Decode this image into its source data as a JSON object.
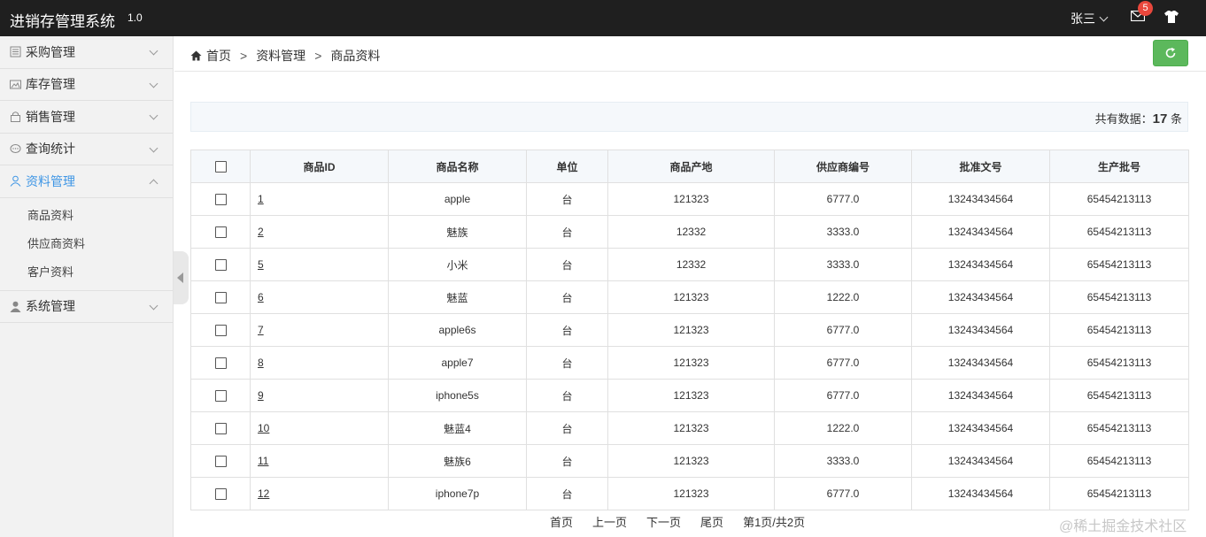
{
  "header": {
    "title": "进销存管理系统",
    "version": "1.0",
    "user_name": "张三",
    "mail_count": "5"
  },
  "sidebar": {
    "items": [
      {
        "label": "采购管理",
        "icon": "list-icon"
      },
      {
        "label": "库存管理",
        "icon": "image-icon"
      },
      {
        "label": "销售管理",
        "icon": "lock-icon"
      },
      {
        "label": "查询统计",
        "icon": "chat-icon"
      },
      {
        "label": "资料管理",
        "icon": "user-icon",
        "active": true
      },
      {
        "label": "系统管理",
        "icon": "person-icon"
      }
    ],
    "subitems": [
      "商品资料",
      "供应商资料",
      "客户资料"
    ]
  },
  "breadcrumb": {
    "items": [
      "首页",
      "资料管理",
      "商品资料"
    ],
    "separator": ">"
  },
  "summary": {
    "prefix": "共有数据：",
    "count": "17",
    "suffix": "条"
  },
  "table": {
    "columns": [
      "商品ID",
      "商品名称",
      "单位",
      "商品产地",
      "供应商编号",
      "批准文号",
      "生产批号"
    ],
    "rows": [
      [
        "1",
        "apple",
        "台",
        "121323",
        "6777.0",
        "13243434564",
        "65454213113"
      ],
      [
        "2",
        "魅族",
        "台",
        "12332",
        "3333.0",
        "13243434564",
        "65454213113"
      ],
      [
        "5",
        "小米",
        "台",
        "12332",
        "3333.0",
        "13243434564",
        "65454213113"
      ],
      [
        "6",
        "魅蓝",
        "台",
        "121323",
        "1222.0",
        "13243434564",
        "65454213113"
      ],
      [
        "7",
        "apple6s",
        "台",
        "121323",
        "6777.0",
        "13243434564",
        "65454213113"
      ],
      [
        "8",
        "apple7",
        "台",
        "121323",
        "6777.0",
        "13243434564",
        "65454213113"
      ],
      [
        "9",
        "iphone5s",
        "台",
        "121323",
        "6777.0",
        "13243434564",
        "65454213113"
      ],
      [
        "10",
        "魅蓝4",
        "台",
        "121323",
        "1222.0",
        "13243434564",
        "65454213113"
      ],
      [
        "11",
        "魅族6",
        "台",
        "121323",
        "3333.0",
        "13243434564",
        "65454213113"
      ],
      [
        "12",
        "iphone7p",
        "台",
        "121323",
        "6777.0",
        "13243434564",
        "65454213113"
      ]
    ]
  },
  "pager": {
    "first": "首页",
    "prev": "上一页",
    "next": "下一页",
    "last": "尾页",
    "status": "第1页/共2页"
  },
  "watermark": "@稀土掘金技术社区",
  "colors": {
    "topbar": "#1f1f1f",
    "active": "#3f96e5",
    "refresh": "#5cb85c",
    "badge": "#e9473c"
  }
}
